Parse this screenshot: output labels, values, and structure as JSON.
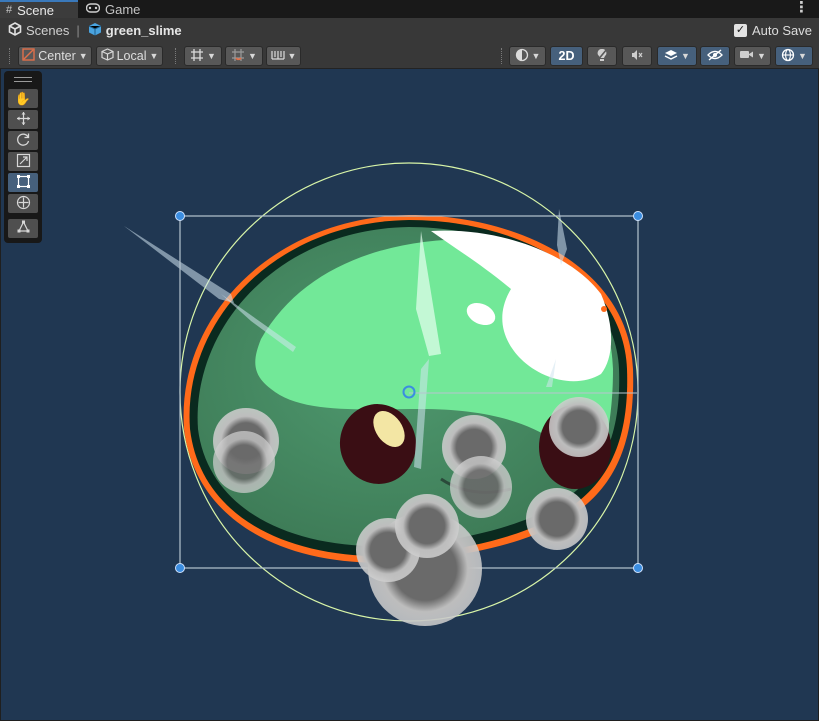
{
  "tabs": [
    {
      "label": "Scene",
      "icon": "grid-icon",
      "active": true
    },
    {
      "label": "Game",
      "icon": "gamepad-icon",
      "active": false
    }
  ],
  "breadcrumb": {
    "scenes_label": "Scenes",
    "object_label": "green_slime"
  },
  "autosave": {
    "label": "Auto Save",
    "checked": true
  },
  "toolbar": {
    "pivot_mode": "Center",
    "pivot_rotation": "Local",
    "mode_2d_label": "2D"
  },
  "tools": [
    "hand-tool",
    "move-tool",
    "rotate-tool",
    "scale-tool",
    "rect-tool",
    "transform-tool",
    "custom-editor-tool"
  ],
  "active_tool": "rect-tool",
  "colors": {
    "scene_background": "#203752",
    "selection_outline": "#ff6a1a",
    "slime_body": "#70e596",
    "accent_blue": "#46607c"
  }
}
